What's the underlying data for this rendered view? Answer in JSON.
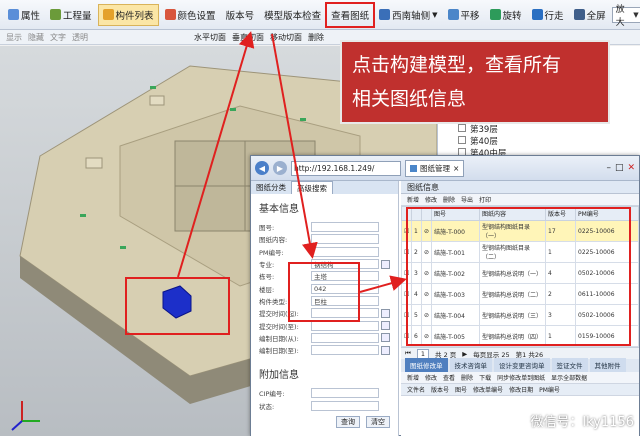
{
  "toolbar": {
    "buttons": [
      {
        "label": "属性",
        "icon": "properties-icon"
      },
      {
        "label": "工程量",
        "icon": "quantity-icon"
      },
      {
        "label": "构件列表",
        "icon": "list-icon"
      },
      {
        "label": "颜色设置",
        "icon": "palette-icon"
      },
      {
        "label": "版本号"
      },
      {
        "label": "模型版本检查"
      },
      {
        "label": "查看图纸"
      },
      {
        "label": "西南轴侧",
        "icon": "axis-icon"
      },
      {
        "label": "平移",
        "icon": "pan-icon"
      },
      {
        "label": "旋转",
        "icon": "rotate-icon"
      },
      {
        "label": "行走",
        "icon": "walk-icon"
      },
      {
        "label": "全屏",
        "icon": "fullscreen-icon"
      }
    ],
    "zoom_select": "放大"
  },
  "toolbar2": {
    "items": [
      "显示",
      "隐藏",
      "文字",
      "透明"
    ],
    "section_buttons": [
      "水平切面",
      "垂直切面",
      "移动切面",
      "删除"
    ]
  },
  "callout": {
    "line1": "点击构建模型，查看所有",
    "line2": "相关图纸信息"
  },
  "tree": {
    "items": [
      "第39层",
      "第40层",
      "第40中层"
    ]
  },
  "browser": {
    "address": "http://192.168.1.249/",
    "tab_title": "图纸管理",
    "left_tabs": [
      "图纸分类",
      "高级搜索"
    ],
    "form_title": "基本信息",
    "fields": [
      {
        "label": "图号:",
        "value": ""
      },
      {
        "label": "图纸内容:",
        "value": ""
      },
      {
        "label": "PM编号:",
        "value": ""
      },
      {
        "label": "专业:",
        "value": "钢结构"
      },
      {
        "label": "栋号:",
        "value": "主塔"
      },
      {
        "label": "楼层:",
        "value": "042"
      },
      {
        "label": "构件类型:",
        "value": "巨柱"
      },
      {
        "label": "提交时间(起):",
        "value": ""
      },
      {
        "label": "提交时间(至):",
        "value": ""
      },
      {
        "label": "编制日期(从):",
        "value": ""
      },
      {
        "label": "编制日期(至):",
        "value": ""
      }
    ],
    "extra_title": "附加信息",
    "extra_fields": [
      "CIP编号:",
      "状态:"
    ],
    "search_buttons": [
      "查询",
      "清空"
    ],
    "table_title": "图纸信息",
    "table_tools": [
      "新增",
      "修改",
      "删除",
      "导出",
      "打印"
    ],
    "columns": [
      "",
      "",
      "",
      "图号",
      "图纸内容",
      "版本号",
      "PM编号"
    ],
    "rows": [
      {
        "n": "1",
        "code": "结施-T-000",
        "content": "型钢结构图纸目录（一）",
        "version": "17",
        "pm": "0225-10006"
      },
      {
        "n": "2",
        "code": "结施-T-001",
        "content": "型钢结构图纸目录（二）",
        "version": "1",
        "pm": "0225-10006"
      },
      {
        "n": "3",
        "code": "结施-T-002",
        "content": "型钢结构总说明（一）",
        "version": "4",
        "pm": "0502-10006"
      },
      {
        "n": "4",
        "code": "结施-T-003",
        "content": "型钢结构总说明（二）",
        "version": "2",
        "pm": "0611-10006"
      },
      {
        "n": "5",
        "code": "结施-T-004",
        "content": "型钢结构总说明（三）",
        "version": "3",
        "pm": "0502-10006"
      },
      {
        "n": "6",
        "code": "结施-T-005",
        "content": "型钢结构总说明（四）",
        "version": "1",
        "pm": "0159-10006"
      }
    ],
    "pager": {
      "page": "1",
      "of": "共 2 页",
      "per_page": "每页显示 25",
      "total": "第1 共26"
    },
    "bottom_tabs": [
      "图纸修改单",
      "技术咨询单",
      "设计变更咨询单",
      "签证文件",
      "其他附件"
    ],
    "bottom_tools": [
      "新增",
      "修改",
      "查看",
      "删除",
      "下载",
      "同步修改单到图纸",
      "显示全部数据"
    ],
    "bottom_cols": [
      "文件名",
      "版本号",
      "图号",
      "修改单编号",
      "修改日期",
      "PM编号"
    ]
  },
  "status": {
    "left_text": "文件显示全部数据"
  },
  "watermark": "微信号：lky1156"
}
